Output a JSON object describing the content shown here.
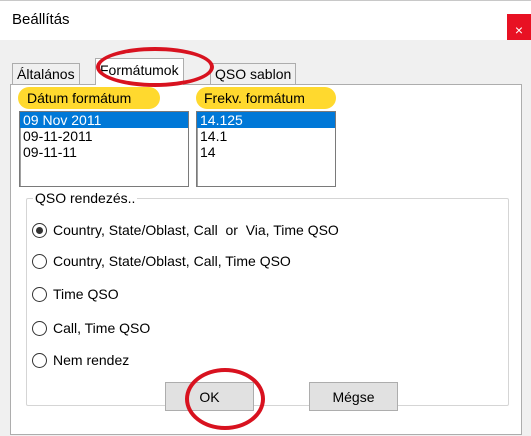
{
  "window": {
    "title": "Beállítás",
    "close_glyph": "×"
  },
  "tabs": [
    {
      "label": "Általános",
      "active": false
    },
    {
      "label": "Formátumok",
      "active": true
    },
    {
      "label": "QSO sablon",
      "active": false
    }
  ],
  "date_format": {
    "label": "Dátum formátum",
    "items": [
      "09 Nov 2011",
      "09-11-2011",
      "09-11-11"
    ],
    "selected": "09 Nov 2011"
  },
  "freq_format": {
    "label": "Frekv. formátum",
    "items": [
      "14.125",
      "14.1",
      "14"
    ],
    "selected": "14.125"
  },
  "qso_sort": {
    "label": "QSO rendezés..",
    "options": [
      {
        "label": "Country, State/Oblast, Call  or  Via, Time QSO",
        "checked": true
      },
      {
        "label": "Country, State/Oblast, Call, Time QSO",
        "checked": false
      },
      {
        "label": "Time QSO",
        "checked": false
      },
      {
        "label": "Call, Time QSO",
        "checked": false
      },
      {
        "label": "Nem rendez",
        "checked": false
      }
    ]
  },
  "buttons": {
    "ok": "OK",
    "cancel": "Mégse"
  },
  "colors": {
    "highlight": "#ffd92e",
    "annotation": "#d8121f",
    "selection": "#0078d7",
    "close": "#e81123"
  }
}
